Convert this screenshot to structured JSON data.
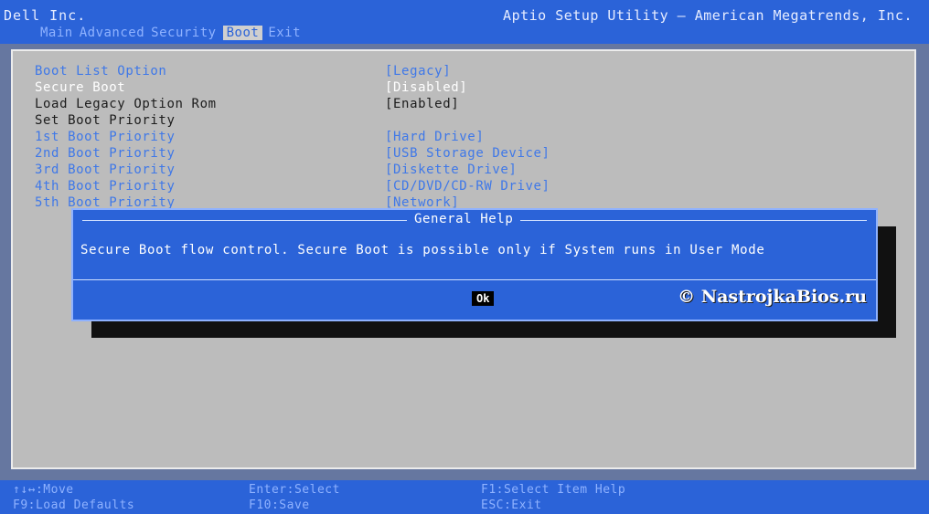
{
  "header": {
    "vendor": "Dell Inc.",
    "utility": "Aptio Setup Utility – American Megatrends, Inc.",
    "tabs": [
      {
        "label": "Main",
        "active": false
      },
      {
        "label": "Advanced",
        "active": false
      },
      {
        "label": "Security",
        "active": false
      },
      {
        "label": "Boot",
        "active": true
      },
      {
        "label": "Exit",
        "active": false
      }
    ]
  },
  "settings": [
    {
      "label": "Boot List Option",
      "value": "[Legacy]"
    },
    {
      "label": "Secure Boot",
      "value": "[Disabled]"
    },
    {
      "label": "Load Legacy Option Rom",
      "value": "[Enabled]"
    },
    {
      "label": "Set Boot Priority",
      "value": ""
    },
    {
      "label": "1st Boot Priority",
      "value": "[Hard Drive]"
    },
    {
      "label": "2nd Boot Priority",
      "value": "[USB Storage Device]"
    },
    {
      "label": "3rd Boot Priority",
      "value": "[Diskette Drive]"
    },
    {
      "label": "4th Boot Priority",
      "value": "[CD/DVD/CD-RW Drive]"
    },
    {
      "label": "5th Boot Priority",
      "value": "[Network]"
    }
  ],
  "dialog": {
    "title": "General Help",
    "message": "Secure Boot flow control. Secure Boot is possible only if System runs in User Mode",
    "ok_label": "Ok",
    "watermark": "© NastrojkaBios.ru"
  },
  "footer": {
    "move": "↑↓↔:Move",
    "enter": "Enter:Select",
    "f1": "F1:Select Item Help",
    "f9": "F9:Load Defaults",
    "f10": "F10:Save",
    "esc": "ESC:Exit"
  },
  "colors": {
    "header_blue": "#2b63d8",
    "panel_gray": "#bcbcbc",
    "item_blue": "#3f78e8"
  }
}
